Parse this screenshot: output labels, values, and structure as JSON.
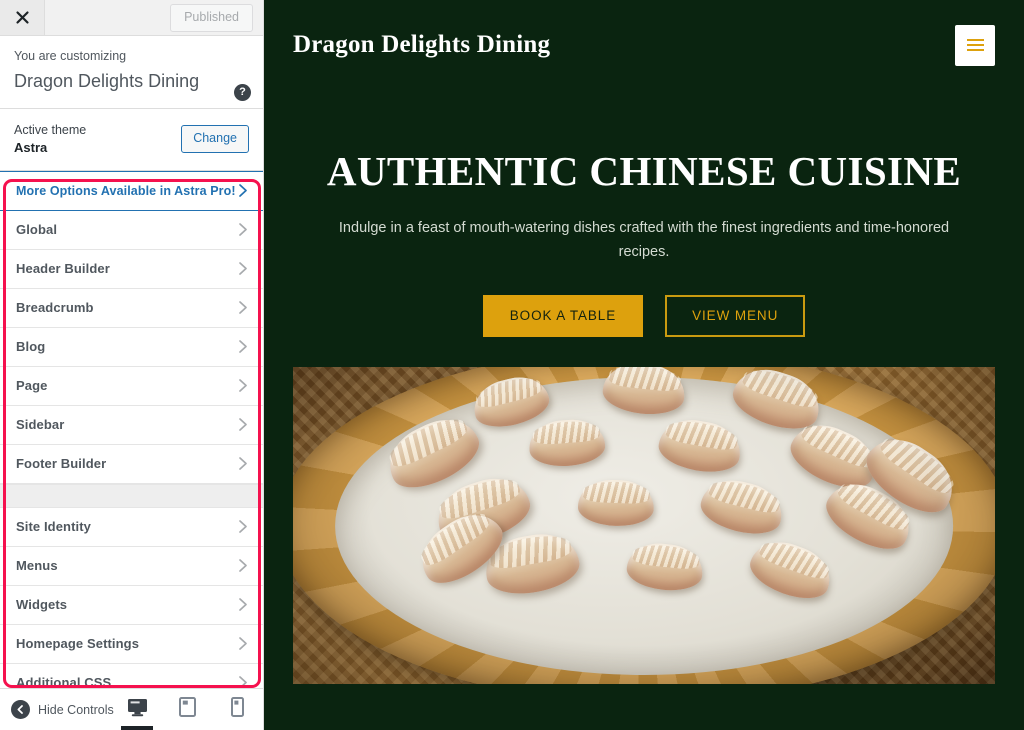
{
  "customizer": {
    "topbar": {
      "close_icon": "close-icon",
      "publish_label": "Published"
    },
    "info": {
      "eyebrow": "You are customizing",
      "site_title": "Dragon Delights Dining",
      "help_icon": "help-icon",
      "help_glyph": "?"
    },
    "theme": {
      "label": "Active theme",
      "name": "Astra",
      "change_label": "Change"
    },
    "menu": [
      {
        "label": "More Options Available in Astra Pro!",
        "kind": "pro"
      },
      {
        "label": "Global",
        "kind": "item"
      },
      {
        "label": "Header Builder",
        "kind": "item"
      },
      {
        "label": "Breadcrumb",
        "kind": "item"
      },
      {
        "label": "Blog",
        "kind": "item"
      },
      {
        "label": "Page",
        "kind": "item"
      },
      {
        "label": "Sidebar",
        "kind": "item"
      },
      {
        "label": "Footer Builder",
        "kind": "item"
      },
      {
        "label": "",
        "kind": "separator"
      },
      {
        "label": "Site Identity",
        "kind": "item"
      },
      {
        "label": "Menus",
        "kind": "item"
      },
      {
        "label": "Widgets",
        "kind": "item"
      },
      {
        "label": "Homepage Settings",
        "kind": "item"
      },
      {
        "label": "Additional CSS",
        "kind": "item"
      }
    ],
    "bottom": {
      "hide_controls_label": "Hide Controls",
      "collapse_icon": "collapse-left-icon",
      "devices": [
        {
          "name": "desktop",
          "icon": "desktop-icon",
          "active": true
        },
        {
          "name": "tablet",
          "icon": "tablet-icon",
          "active": false
        },
        {
          "name": "mobile",
          "icon": "mobile-icon",
          "active": false
        }
      ]
    },
    "annotation": {
      "color": "#f5114e"
    }
  },
  "preview": {
    "header": {
      "brand": "Dragon Delights Dining",
      "menu_toggle_icon": "hamburger-menu-icon"
    },
    "hero": {
      "heading": "AUTHENTIC CHINESE CUISINE",
      "subheading": "Indulge in a feast of mouth-watering dishes crafted with the finest ingredients and time-honored recipes.",
      "primary_button": "BOOK A TABLE",
      "secondary_button": "VIEW MENU"
    },
    "image": {
      "name": "dumplings-in-bamboo-steamer-photo"
    }
  },
  "colors": {
    "site_background": "#0a2410",
    "accent_gold": "#dda10d",
    "accent_gold_border": "#c99a10",
    "button_text_dark": "#14230f",
    "subheading_text": "#d4dbd2",
    "annotation_red": "#f5114e",
    "link_blue": "#2271b1"
  }
}
